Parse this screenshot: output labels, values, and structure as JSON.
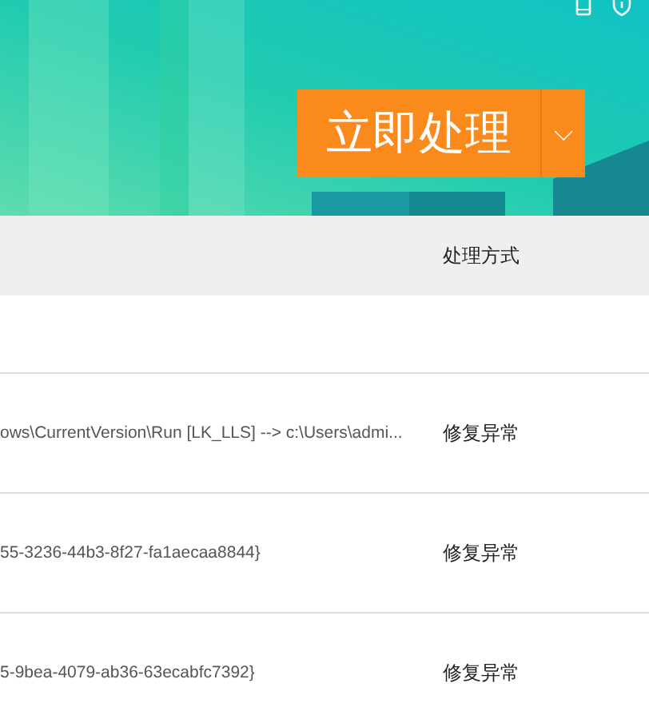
{
  "banner": {
    "action_button": "立即处理",
    "dropdown_symbol": "⌵"
  },
  "table": {
    "columns": [
      "处理方式"
    ],
    "rows": [
      {
        "item": "",
        "action": ""
      },
      {
        "item": "ows\\CurrentVersion\\Run [LK_LLS] --> c:\\Users\\admi...",
        "action": "修复异常"
      },
      {
        "item": "55-3236-44b3-8f27-fa1aecaa8844}",
        "action": "修复异常"
      },
      {
        "item": "5-9bea-4079-ab36-63ecabfc7392}",
        "action": "修复异常"
      }
    ]
  }
}
